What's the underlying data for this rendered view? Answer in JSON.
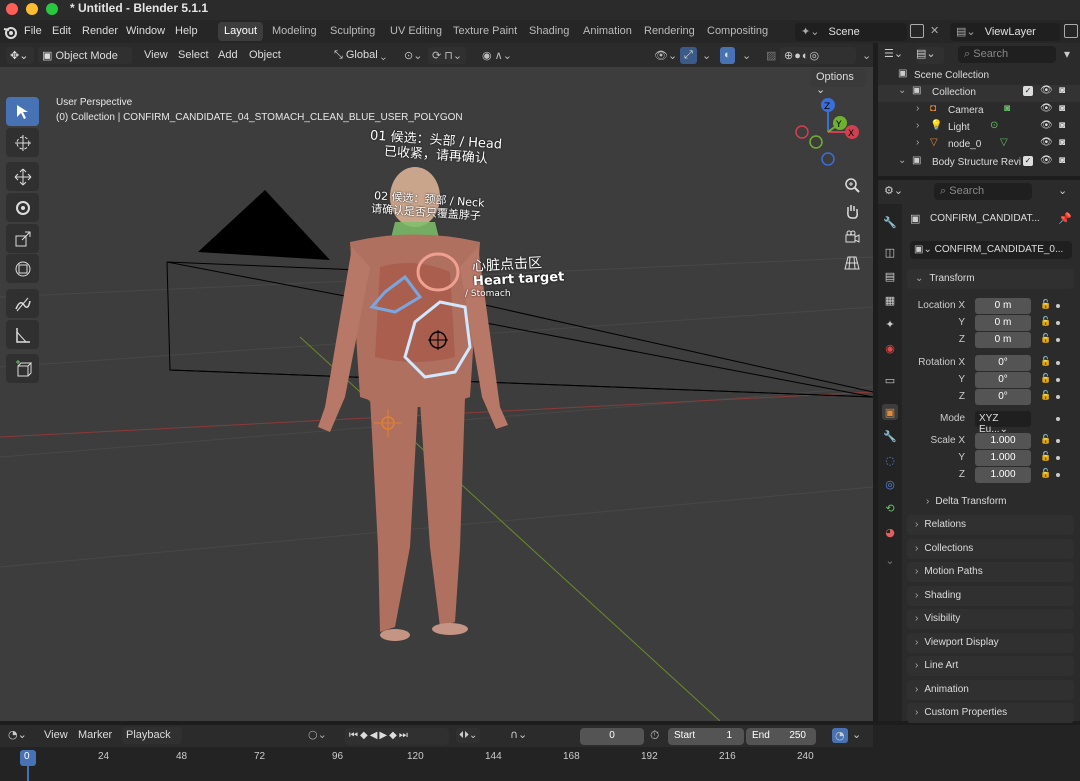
{
  "window": {
    "title": "* Untitled - Blender 5.1.1"
  },
  "menu": {
    "items": [
      "File",
      "Edit",
      "Render",
      "Window",
      "Help"
    ]
  },
  "workspaces": [
    "Layout",
    "Modeling",
    "Sculpting",
    "UV Editing",
    "Texture Paint",
    "Shading",
    "Animation",
    "Rendering",
    "Compositing"
  ],
  "scene": {
    "label": "Scene",
    "viewlayer": "ViewLayer"
  },
  "viewport_header": {
    "mode": "Object Mode",
    "view": "View",
    "select": "Select",
    "add": "Add",
    "object": "Object",
    "orientation": "Global",
    "options": "Options"
  },
  "viewport": {
    "perspective": "User Perspective",
    "collection_info": "(0) Collection | CONFIRM_CANDIDATE_04_STOMACH_CLEAN_BLUE_USER_POLYGON"
  },
  "annotations": {
    "head_line1": "01 候选：头部 / Head",
    "head_line2": "已收紧，请再确认",
    "neck_line1": "02 候选：颈部 / Neck",
    "neck_line2": "请确认是否只覆盖脖子",
    "heart_cn": "心脏点击区",
    "heart_en": "Heart target",
    "stomach": "/ Stomach"
  },
  "gizmo": {
    "z": "Z",
    "y": "Y",
    "x": "X"
  },
  "outliner": {
    "search_placeholder": "Search",
    "rows": [
      {
        "name": "Scene Collection"
      },
      {
        "name": "Collection"
      },
      {
        "name": "Camera"
      },
      {
        "name": "Light"
      },
      {
        "name": "node_0"
      },
      {
        "name": "Body Structure Revi"
      }
    ]
  },
  "properties": {
    "search_placeholder": "Search",
    "object_name": "CONFIRM_CANDIDAT...",
    "data_name": "CONFIRM_CANDIDATE_0...",
    "transform_title": "Transform",
    "location": {
      "label": "Location X",
      "x": "0 m",
      "y": "0 m",
      "z": "0 m"
    },
    "rotation": {
      "label": "Rotation X",
      "x": "0°",
      "y": "0°",
      "z": "0°"
    },
    "mode": {
      "label": "Mode",
      "value": "XYZ Eu..."
    },
    "scale": {
      "label": "Scale X",
      "x": "1.000",
      "y": "1.000",
      "z": "1.000"
    },
    "axis": {
      "y": "Y",
      "z": "Z"
    },
    "delta": "Delta Transform",
    "panels": [
      "Relations",
      "Collections",
      "Motion Paths",
      "Shading",
      "Visibility",
      "Viewport Display",
      "Line Art",
      "Animation",
      "Custom Properties"
    ]
  },
  "timeline": {
    "view": "View",
    "marker": "Marker",
    "playback": "Playback",
    "current": "0",
    "start_label": "Start",
    "start": "1",
    "end_label": "End",
    "end": "250",
    "ticks": [
      "0",
      "24",
      "48",
      "72",
      "96",
      "120",
      "144",
      "168",
      "192",
      "216",
      "240"
    ]
  },
  "colors": {
    "accent": "#4772b3",
    "bg": "#3d3d3d",
    "panel": "#2b2b2b"
  }
}
